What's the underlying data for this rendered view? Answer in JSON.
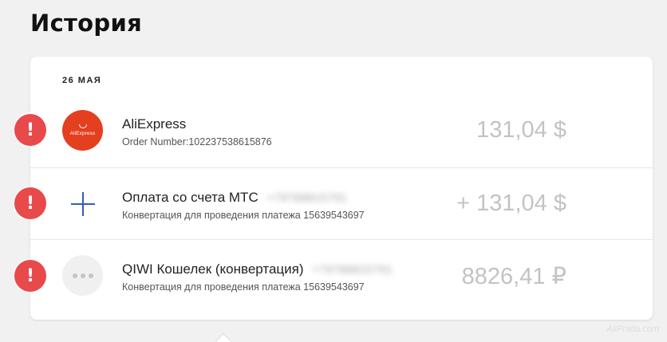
{
  "page": {
    "title": "История",
    "watermark": "AliPrada.com"
  },
  "history": {
    "date_label": "26 МАЯ",
    "transactions": [
      {
        "icon": "aliexpress-logo",
        "logo_text": "AliExpress",
        "title": "AliExpress",
        "title_extra": "",
        "subtitle": "Order Number:102237538615876",
        "amount": "131,04 $",
        "status_icon": "exclamation-icon"
      },
      {
        "icon": "plus-icon",
        "title": "Оплата со счета МТС",
        "title_extra": "+79788815791",
        "subtitle": "Конвертация для проведения платежа 15639543697",
        "amount": "+ 131,04 $",
        "status_icon": "exclamation-icon"
      },
      {
        "icon": "dots-icon",
        "title": "QIWI Кошелек (конвертация)",
        "title_extra": "+79788815791",
        "subtitle": "Конвертация для проведения платежа 15639543697",
        "amount": "8826,41 ₽",
        "status_icon": "exclamation-icon"
      }
    ]
  },
  "colors": {
    "warning": "#e8494a",
    "aliexpress": "#e43f1f",
    "plus": "#2f5fb5",
    "amount": "#c3c3c3"
  },
  "status": {
    "warning_glyph": "!"
  }
}
